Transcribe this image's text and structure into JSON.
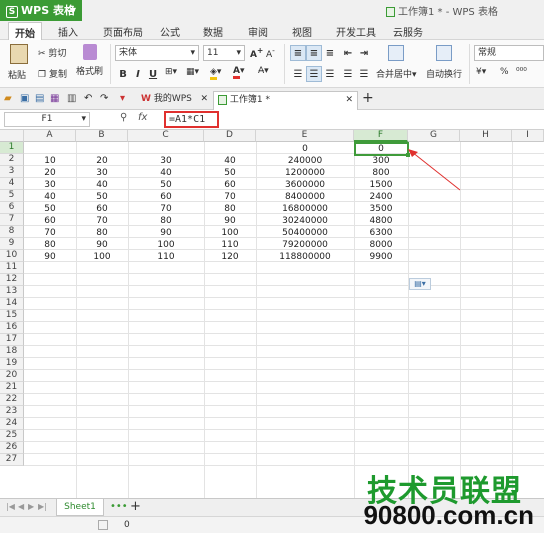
{
  "app": {
    "name": "WPS 表格",
    "window_title": "工作簿1 * - WPS 表格"
  },
  "menu": [
    "开始",
    "插入",
    "页面布局",
    "公式",
    "数据",
    "审阅",
    "视图",
    "开发工具",
    "云服务"
  ],
  "ribbon": {
    "paste": "粘贴",
    "cut": "剪切",
    "copy": "复制",
    "format_painter": "格式刷",
    "font_name": "宋体",
    "font_size": "11",
    "bold": "B",
    "italic": "I",
    "underline": "U",
    "merge_center": "合并居中",
    "wrap_text": "自动换行",
    "number_format": "常规",
    "percent": "%"
  },
  "tabs": {
    "my_wps": "我的WPS",
    "workbook": "工作簿1 *",
    "add": "+"
  },
  "formula_bar": {
    "name_box": "F1",
    "fx": "fx",
    "formula": "=A1*C1"
  },
  "columns": [
    "A",
    "B",
    "C",
    "D",
    "E",
    "F",
    "G",
    "H",
    "I"
  ],
  "rows": [
    "1",
    "2",
    "3",
    "4",
    "5",
    "6",
    "7",
    "8",
    "9",
    "10",
    "11",
    "12",
    "13",
    "14",
    "15",
    "16",
    "17",
    "18",
    "19",
    "20",
    "21",
    "22",
    "23",
    "24",
    "25",
    "26",
    "27"
  ],
  "cells": {
    "r1": {
      "E": "0",
      "F": "0"
    },
    "r2": [
      "10",
      "20",
      "30",
      "40",
      "240000",
      "300"
    ],
    "r3": [
      "20",
      "30",
      "40",
      "50",
      "1200000",
      "800"
    ],
    "r4": [
      "30",
      "40",
      "50",
      "60",
      "3600000",
      "1500"
    ],
    "r5": [
      "40",
      "50",
      "60",
      "70",
      "8400000",
      "2400"
    ],
    "r6": [
      "50",
      "60",
      "70",
      "80",
      "16800000",
      "3500"
    ],
    "r7": [
      "60",
      "70",
      "80",
      "90",
      "30240000",
      "4800"
    ],
    "r8": [
      "70",
      "80",
      "90",
      "100",
      "50400000",
      "6300"
    ],
    "r9": [
      "80",
      "90",
      "100",
      "110",
      "79200000",
      "8000"
    ],
    "r10": [
      "90",
      "100",
      "110",
      "120",
      "118800000",
      "9900"
    ]
  },
  "selection": {
    "cell": "F1"
  },
  "sheet": {
    "name": "Sheet1",
    "add": "+"
  },
  "status": {
    "value": "0"
  },
  "watermark": {
    "line1": "技术员联盟",
    "line2": "90800.com.cn"
  },
  "colors": {
    "brand_green": "#3b9b35",
    "highlight_red": "#e0302e",
    "watermark_green": "#1e9a2e"
  }
}
